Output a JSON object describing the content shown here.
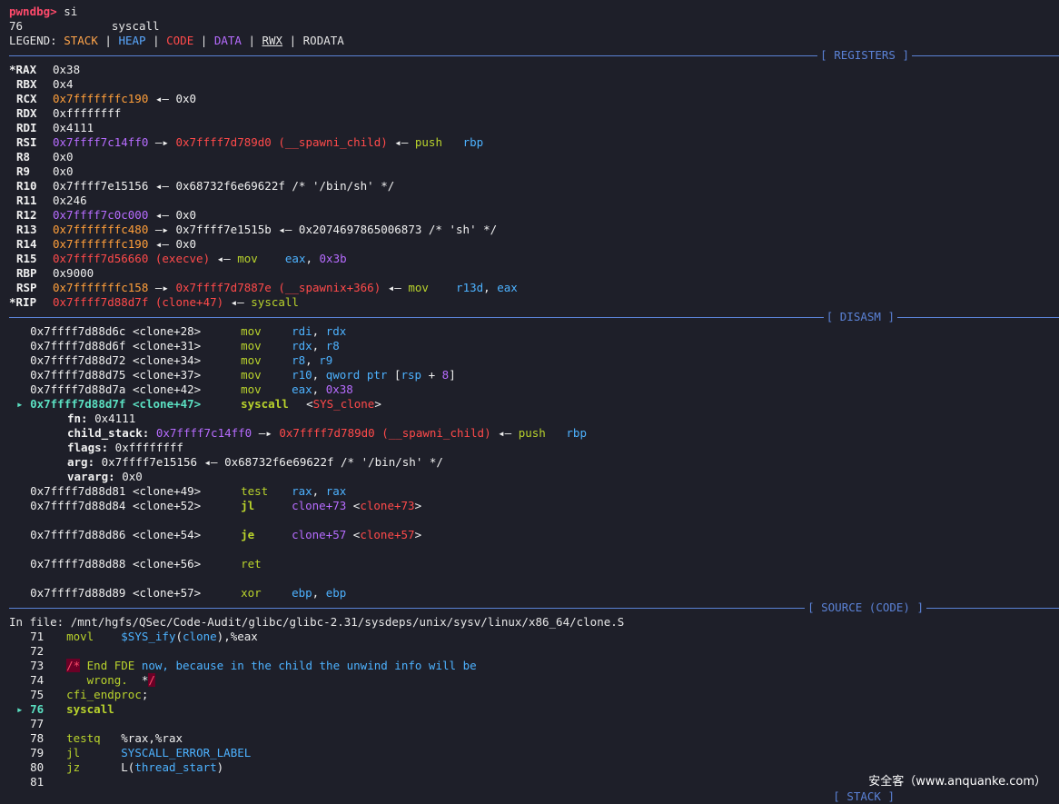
{
  "prompt": "pwndbg>",
  "command": "si",
  "syscall_line": "76             syscall",
  "legend": {
    "label": "LEGEND:",
    "stack": "STACK",
    "heap": "HEAP",
    "code": "CODE",
    "data": "DATA",
    "rwx": "RWX",
    "rodata": "RODATA",
    "sep": " | "
  },
  "sections": {
    "registers": "[ REGISTERS ]",
    "disasm": "[ DISASM ]",
    "source": "[ SOURCE (CODE) ]",
    "stack": "[ STACK ]"
  },
  "registers": [
    {
      "name": "*RAX",
      "parts": [
        [
          "w",
          "0x38"
        ]
      ]
    },
    {
      "name": "RBX",
      "parts": [
        [
          "w",
          "0x4"
        ]
      ]
    },
    {
      "name": "RCX",
      "parts": [
        [
          "o",
          "0x7fffffffc190"
        ],
        [
          "w",
          " ◂— 0x0"
        ]
      ]
    },
    {
      "name": "RDX",
      "parts": [
        [
          "w",
          "0xffffffff"
        ]
      ]
    },
    {
      "name": "RDI",
      "parts": [
        [
          "w",
          "0x4111"
        ]
      ]
    },
    {
      "name": "RSI",
      "parts": [
        [
          "p",
          "0x7ffff7c14ff0"
        ],
        [
          "w",
          " —▸ "
        ],
        [
          "r",
          "0x7ffff7d789d0 (__spawni_child)"
        ],
        [
          "w",
          " ◂— "
        ],
        [
          "g",
          "push"
        ],
        [
          "w",
          "   "
        ],
        [
          "b",
          "rbp"
        ]
      ]
    },
    {
      "name": "R8",
      "parts": [
        [
          "w",
          "0x0"
        ]
      ]
    },
    {
      "name": "R9",
      "parts": [
        [
          "w",
          "0x0"
        ]
      ]
    },
    {
      "name": "R10",
      "parts": [
        [
          "w",
          "0x7ffff7e15156 ◂— 0x68732f6e69622f /* '/bin/sh' */"
        ]
      ]
    },
    {
      "name": "R11",
      "parts": [
        [
          "w",
          "0x246"
        ]
      ]
    },
    {
      "name": "R12",
      "parts": [
        [
          "p",
          "0x7ffff7c0c000"
        ],
        [
          "w",
          " ◂— 0x0"
        ]
      ]
    },
    {
      "name": "R13",
      "parts": [
        [
          "o",
          "0x7fffffffc480"
        ],
        [
          "w",
          " —▸ 0x7ffff7e1515b ◂— 0x2074697865006873 /* 'sh' */"
        ]
      ]
    },
    {
      "name": "R14",
      "parts": [
        [
          "o",
          "0x7fffffffc190"
        ],
        [
          "w",
          " ◂— 0x0"
        ]
      ]
    },
    {
      "name": "R15",
      "parts": [
        [
          "r",
          "0x7ffff7d56660 (execve)"
        ],
        [
          "w",
          " ◂— "
        ],
        [
          "g",
          "mov"
        ],
        [
          "w",
          "    "
        ],
        [
          "b",
          "eax"
        ],
        [
          "w",
          ", "
        ],
        [
          "p",
          "0x3b"
        ]
      ]
    },
    {
      "name": "RBP",
      "parts": [
        [
          "w",
          "0x9000"
        ]
      ]
    },
    {
      "name": "RSP",
      "parts": [
        [
          "o",
          "0x7fffffffc158"
        ],
        [
          "w",
          " —▸ "
        ],
        [
          "r",
          "0x7ffff7d7887e (__spawnix+366)"
        ],
        [
          "w",
          " ◂— "
        ],
        [
          "g",
          "mov"
        ],
        [
          "w",
          "    "
        ],
        [
          "b",
          "r13d"
        ],
        [
          "w",
          ", "
        ],
        [
          "b",
          "eax"
        ]
      ]
    },
    {
      "name": "*RIP",
      "parts": [
        [
          "r",
          "0x7ffff7d88d7f (clone+47)"
        ],
        [
          "w",
          " ◂— "
        ],
        [
          "g",
          "syscall"
        ]
      ]
    }
  ],
  "disasm": [
    {
      "cur": false,
      "addr": "0x7ffff7d88d6c <clone+28>",
      "mn": "mov",
      "ops": [
        [
          "b",
          "rdi"
        ],
        [
          "w",
          ", "
        ],
        [
          "b",
          "rdx"
        ]
      ]
    },
    {
      "cur": false,
      "addr": "0x7ffff7d88d6f <clone+31>",
      "mn": "mov",
      "ops": [
        [
          "b",
          "rdx"
        ],
        [
          "w",
          ", "
        ],
        [
          "b",
          "r8"
        ]
      ]
    },
    {
      "cur": false,
      "addr": "0x7ffff7d88d72 <clone+34>",
      "mn": "mov",
      "ops": [
        [
          "b",
          "r8"
        ],
        [
          "w",
          ", "
        ],
        [
          "b",
          "r9"
        ]
      ]
    },
    {
      "cur": false,
      "addr": "0x7ffff7d88d75 <clone+37>",
      "mn": "mov",
      "ops": [
        [
          "b",
          "r10"
        ],
        [
          "w",
          ", "
        ],
        [
          "b",
          "qword ptr"
        ],
        [
          "w",
          " ["
        ],
        [
          "b",
          "rsp"
        ],
        [
          "w",
          " + "
        ],
        [
          "p",
          "8"
        ],
        [
          "w",
          "]"
        ]
      ]
    },
    {
      "cur": false,
      "addr": "0x7ffff7d88d7a <clone+42>",
      "mn": "mov",
      "ops": [
        [
          "b",
          "eax"
        ],
        [
          "w",
          ", "
        ],
        [
          "p",
          "0x38"
        ]
      ]
    },
    {
      "cur": true,
      "addr": "0x7ffff7d88d7f <clone+47>",
      "mn": "syscall",
      "ops": [
        [
          "w",
          "<"
        ],
        [
          "r",
          "SYS_clone"
        ],
        [
          "w",
          ">"
        ]
      ]
    },
    {
      "args": [
        [
          "fn:",
          " 0x4111",
          []
        ],
        [
          "child_stack:",
          "",
          [
            [
              "p",
              " 0x7ffff7c14ff0"
            ],
            [
              "w",
              " —▸ "
            ],
            [
              "r",
              "0x7ffff7d789d0 (__spawni_child)"
            ],
            [
              "w",
              " ◂— "
            ],
            [
              "g",
              "push"
            ],
            [
              "w",
              "   "
            ],
            [
              "b",
              "rbp"
            ]
          ]
        ],
        [
          "flags:",
          " 0xffffffff",
          []
        ],
        [
          "arg:",
          " 0x7ffff7e15156 ◂— 0x68732f6e69622f /* '/bin/sh' */",
          []
        ],
        [
          "vararg:",
          " 0x0",
          []
        ]
      ]
    },
    {
      "cur": false,
      "addr": "0x7ffff7d88d81 <clone+49>",
      "mn": "test",
      "ops": [
        [
          "b",
          "rax"
        ],
        [
          "w",
          ", "
        ],
        [
          "b",
          "rax"
        ]
      ]
    },
    {
      "cur": false,
      "addr": "0x7ffff7d88d84 <clone+52>",
      "mn": "jl",
      "bold": true,
      "ops": [
        [
          "p",
          "clone+73"
        ],
        [
          "w",
          " <"
        ],
        [
          "r",
          "clone+73"
        ],
        [
          "w",
          ">"
        ]
      ]
    },
    {
      "blank": true
    },
    {
      "cur": false,
      "addr": "0x7ffff7d88d86 <clone+54>",
      "mn": "je",
      "bold": true,
      "ops": [
        [
          "p",
          "clone+57"
        ],
        [
          "w",
          " <"
        ],
        [
          "r",
          "clone+57"
        ],
        [
          "w",
          ">"
        ]
      ]
    },
    {
      "blank": true
    },
    {
      "cur": false,
      "addr": "0x7ffff7d88d88 <clone+56>",
      "mn": "ret",
      "ops": []
    },
    {
      "blank": true
    },
    {
      "cur": false,
      "addr": "0x7ffff7d88d89 <clone+57>",
      "mn": "xor",
      "ops": [
        [
          "b",
          "ebp"
        ],
        [
          "w",
          ", "
        ],
        [
          "b",
          "ebp"
        ]
      ]
    }
  ],
  "source_file": "In file: /mnt/hgfs/QSec/Code-Audit/glibc/glibc-2.31/sysdeps/unix/sysv/linux/x86_64/clone.S",
  "source": [
    {
      "n": "71",
      "cur": false,
      "parts": [
        [
          "g",
          "movl"
        ],
        [
          "w",
          "    "
        ],
        [
          "b",
          "$SYS_ify"
        ],
        [
          "w",
          "("
        ],
        [
          "b",
          "clone"
        ],
        [
          "w",
          "),%eax"
        ]
      ]
    },
    {
      "n": "72",
      "cur": false,
      "parts": []
    },
    {
      "n": "73",
      "cur": false,
      "parts": [
        [
          "box",
          "/*"
        ],
        [
          "g",
          " End FDE "
        ],
        [
          "b",
          "now, because in the child the unwind info will be"
        ]
      ]
    },
    {
      "n": "74",
      "cur": false,
      "parts": [
        [
          "g",
          "   wrong."
        ],
        [
          "w",
          "  *"
        ],
        [
          "box",
          "/"
        ]
      ]
    },
    {
      "n": "75",
      "cur": false,
      "parts": [
        [
          "g",
          "cfi_endproc"
        ],
        [
          "w",
          ";"
        ]
      ]
    },
    {
      "n": "76",
      "cur": true,
      "parts": [
        [
          "gb",
          "syscall"
        ]
      ]
    },
    {
      "n": "77",
      "cur": false,
      "parts": []
    },
    {
      "n": "78",
      "cur": false,
      "parts": [
        [
          "g",
          "testq"
        ],
        [
          "w",
          "   %rax,%rax"
        ]
      ]
    },
    {
      "n": "79",
      "cur": false,
      "parts": [
        [
          "g",
          "jl"
        ],
        [
          "w",
          "      "
        ],
        [
          "b",
          "SYSCALL_ERROR_LABEL"
        ]
      ]
    },
    {
      "n": "80",
      "cur": false,
      "parts": [
        [
          "g",
          "jz"
        ],
        [
          "w",
          "      L("
        ],
        [
          "b",
          "thread_start"
        ],
        [
          "w",
          ")"
        ]
      ]
    },
    {
      "n": "81",
      "cur": false,
      "parts": []
    }
  ],
  "watermark": "安全客（www.anquanke.com）"
}
